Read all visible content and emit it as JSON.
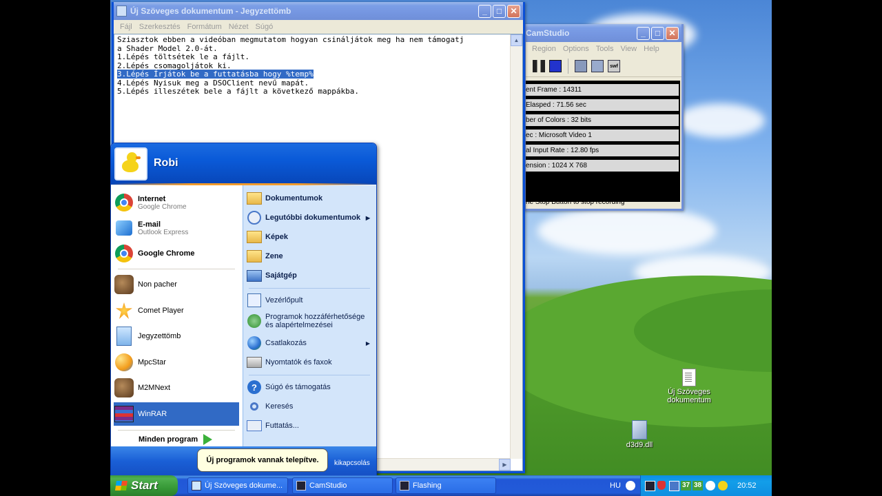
{
  "notepad": {
    "title": "Új Szöveges dokumentum - Jegyzettömb",
    "menu": [
      "Fájl",
      "Szerkesztés",
      "Formátum",
      "Nézet",
      "Súgó"
    ],
    "lines": [
      "Sziasztok ebben a videóban megmutatom hogyan csináljátok meg ha nem támogatj",
      "a Shader Model 2.0-át.",
      "1.Lépés töltsétek le a fájlt.",
      "2.Lépés csomagoljátok ki.",
      "3.Lépés Írjátok be a futtatásba hogy %temp%",
      "4.Lépés Nyisuk meg a DSOClient nevű mapát.",
      "5.Lépés illeszétek bele a fájlt a következő mappákba."
    ]
  },
  "camstudio": {
    "title": "CamStudio",
    "menu": [
      "Region",
      "Options",
      "Tools",
      "View",
      "Help"
    ],
    "stats": [
      "ent Frame : 14311",
      " Elasped : 71.56 sec",
      "ber of Colors  : 32 bits",
      "ec  : Microsoft Video 1",
      "al Input Rate  : 12.80 fps",
      "ension  : 1024 X 768"
    ],
    "status": "he Stop Button to stop recording"
  },
  "desktop_icons": [
    {
      "label": "Új Szöveges dokumentum",
      "icon": "text-document-icon"
    },
    {
      "label": "d3d9.dll",
      "icon": "dll-file-icon"
    }
  ],
  "start_menu": {
    "user": "Robi",
    "pinned": [
      {
        "title": "Internet",
        "subtitle": "Google Chrome",
        "icon": "chrome-icon"
      },
      {
        "title": "E-mail",
        "subtitle": "Outlook Express",
        "icon": "outlook-express-icon"
      }
    ],
    "recent": [
      {
        "label": "Google Chrome",
        "icon": "chrome-icon"
      },
      {
        "label": "Non pacher",
        "icon": "app-icon"
      },
      {
        "label": "Comet Player",
        "icon": "comet-player-icon"
      },
      {
        "label": "Jegyzettömb",
        "icon": "notepad-icon"
      },
      {
        "label": "MpcStar",
        "icon": "mpcstar-icon"
      },
      {
        "label": "M2MNext",
        "icon": "app-icon"
      },
      {
        "label": "WinRAR",
        "icon": "winrar-icon"
      }
    ],
    "all_programs": "Minden program",
    "right": [
      {
        "label": "Dokumentumok",
        "icon": "documents-icon"
      },
      {
        "label": "Legutóbbi dokumentumok",
        "icon": "recent-documents-icon"
      },
      {
        "label": "Képek",
        "icon": "pictures-icon"
      },
      {
        "label": "Zene",
        "icon": "music-icon"
      },
      {
        "label": "Sajátgép",
        "icon": "my-computer-icon"
      },
      {
        "label": "Vezérlőpult",
        "icon": "control-panel-icon"
      },
      {
        "label": "Programok hozzáférhetősége",
        "label2": "és alapértelmezései",
        "icon": "program-defaults-icon"
      },
      {
        "label": "Csatlakozás",
        "icon": "connect-icon"
      },
      {
        "label": "Nyomtatók és faxok",
        "icon": "printer-icon"
      },
      {
        "label": "Súgó és támogatás",
        "icon": "help-icon"
      },
      {
        "label": "Keresés",
        "icon": "search-icon"
      },
      {
        "label": "Futtatás...",
        "icon": "run-icon"
      }
    ],
    "footer_text": "kikapcsolás"
  },
  "balloon": "Új programok vannak telepítve.",
  "taskbar": {
    "start": "Start",
    "tasks": [
      {
        "label": "Új Szöveges dokume...",
        "icon": "notepad-icon"
      },
      {
        "label": "CamStudio",
        "icon": "camstudio-icon"
      },
      {
        "label": "Flashing",
        "icon": "flashing-icon"
      }
    ],
    "lang": "HU",
    "tray_numbers": [
      "37",
      "38"
    ],
    "clock": "20:52"
  },
  "colors": {
    "xp_blue": "#0054e3",
    "selection": "#316ac5",
    "start_green": "#379937"
  }
}
